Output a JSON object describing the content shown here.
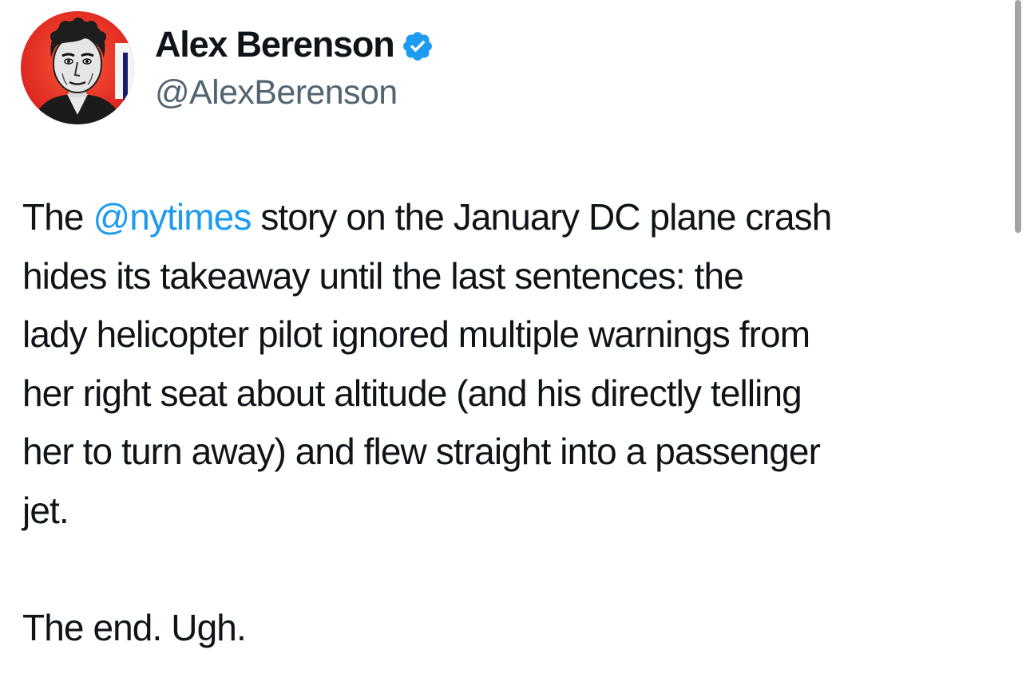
{
  "author": {
    "display_name": "Alex Berenson",
    "handle": "@AlexBerenson",
    "verified": true,
    "verified_badge_color": "#1d9bf0"
  },
  "tweet": {
    "line1_before": "The ",
    "mention": "@nytimes",
    "line1_after": " story on the January DC plane crash",
    "line2": "hides its takeaway until the last sentences: the",
    "line3": "lady helicopter pilot ignored multiple warnings from",
    "line4": "her right seat about altitude (and his directly telling",
    "line5": "her to turn away) and flew straight into a passenger",
    "line6": "jet.",
    "closing": "The end. Ugh."
  },
  "colors": {
    "text": "#0f1419",
    "secondary": "#536471",
    "link": "#1d9bf0",
    "avatar_bg": "#e8302a"
  },
  "icons": {
    "avatar": "avatar-portrait",
    "badge": "verified-badge-icon"
  }
}
